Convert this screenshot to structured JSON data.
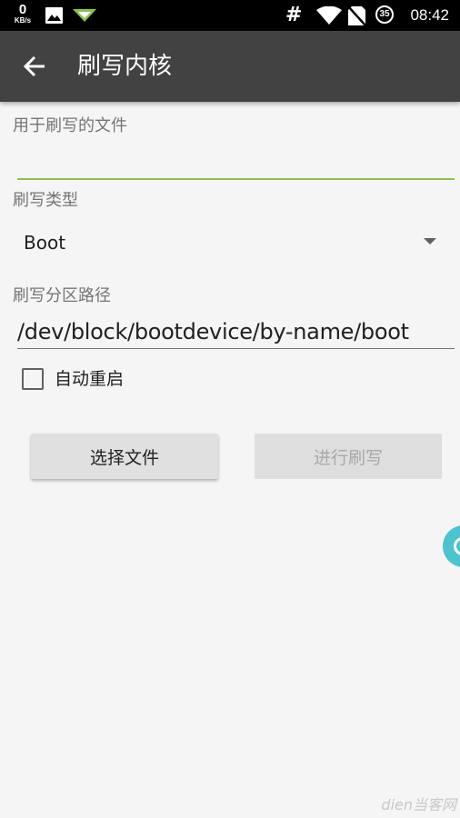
{
  "status_bar": {
    "net_speed_value": "0",
    "net_speed_unit": "KB/s",
    "hash_symbol": "#",
    "battery_level": "35",
    "time": "08:42",
    "icons": [
      "image-icon",
      "notification-icon",
      "wifi-icon",
      "no-sim-icon",
      "battery-icon"
    ]
  },
  "app_bar": {
    "title": "刷写内核",
    "back_icon": "arrow-back-icon",
    "background": "#424242"
  },
  "form": {
    "file_label": "用于刷写的文件",
    "file_value": "",
    "flash_type_label": "刷写类型",
    "flash_type_value": "Boot",
    "partition_label": "刷写分区路径",
    "partition_value": "/dev/block/bootdevice/by-name/boot",
    "auto_reboot_label": "自动重启",
    "auto_reboot_checked": false,
    "accent_color": "#8bc34a"
  },
  "actions": {
    "select_file_label": "选择文件",
    "flash_label": "进行刷写",
    "flash_enabled": false
  },
  "watermark": {
    "text": "dien当客网"
  }
}
